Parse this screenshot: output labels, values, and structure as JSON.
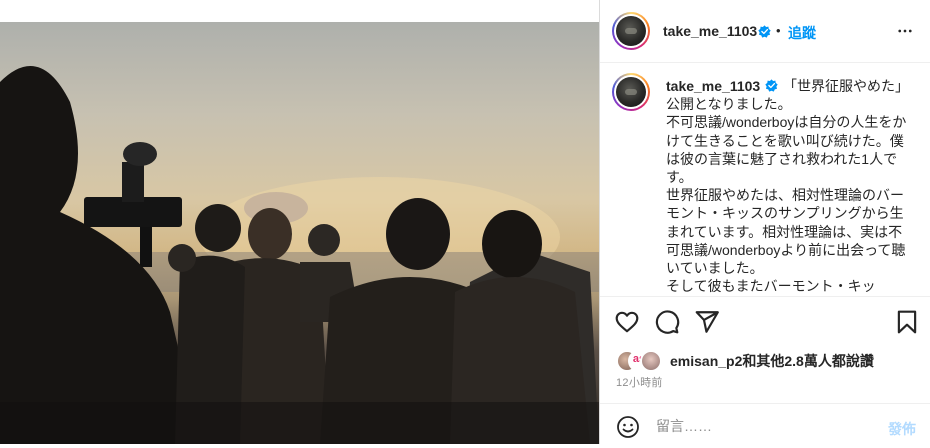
{
  "post": {
    "image": {
      "description_icon": "photo-icon"
    },
    "author": {
      "username": "take_me_1103",
      "verified": true,
      "follow_label": "追蹤",
      "separator": "•"
    },
    "caption": {
      "username": "take_me_1103",
      "lines": [
        "「世界征服やめた」公開となりました。",
        "不可思議/wonderboyは自分の人生をかけて生きることを歌い叫び続けた。僕は彼の言葉に魅了され救われた1人です。",
        "世界征服やめたは、相対性理論のバーモント・キッスのサンプリングから生まれています。相対性理論は、実は不可思議/wonderboyより前に出会って聴いていました。",
        "そして彼もまたバーモント・キッ"
      ]
    },
    "likes": {
      "text": "emisan_p2和其他2.8萬人都說讚",
      "badge": "as"
    },
    "time": "12小時前",
    "comment": {
      "placeholder": "留言……",
      "post_label": "發佈"
    },
    "colors": {
      "accent": "#0095f6",
      "post_disabled": "#b3dbff",
      "text": "#262626",
      "muted": "#8e8e8e"
    },
    "icons": [
      "heart-icon",
      "comment-icon",
      "share-icon",
      "bookmark-icon",
      "emoji-icon",
      "more-icon",
      "verified-icon"
    ]
  }
}
